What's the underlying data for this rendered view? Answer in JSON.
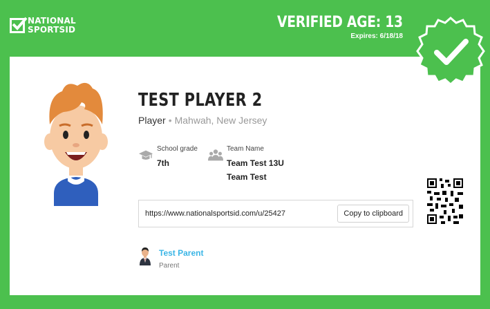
{
  "brand": {
    "line1": "NATIONAL",
    "line2": "SPORTSID"
  },
  "verification": {
    "age_text": "VERIFIED AGE: 13",
    "expires_text": "Expires: 6/18/18"
  },
  "player": {
    "name": "TEST PLAYER 2",
    "role": "Player",
    "separator": "•",
    "location": "Mahwah, New Jersey"
  },
  "school": {
    "label": "School grade",
    "value": "7th",
    "icon": "graduation-cap-icon"
  },
  "team": {
    "label": "Team Name",
    "values": [
      "Team Test 13U",
      "Team Test"
    ],
    "icon": "group-icon"
  },
  "profile": {
    "url": "https://www.nationalsportsid.com/u/25427",
    "copy_label": "Copy to clipboard"
  },
  "parent": {
    "name": "Test Parent",
    "role": "Parent"
  },
  "colors": {
    "brand_green": "#4cc04e",
    "link_blue": "#3ab5e6"
  }
}
